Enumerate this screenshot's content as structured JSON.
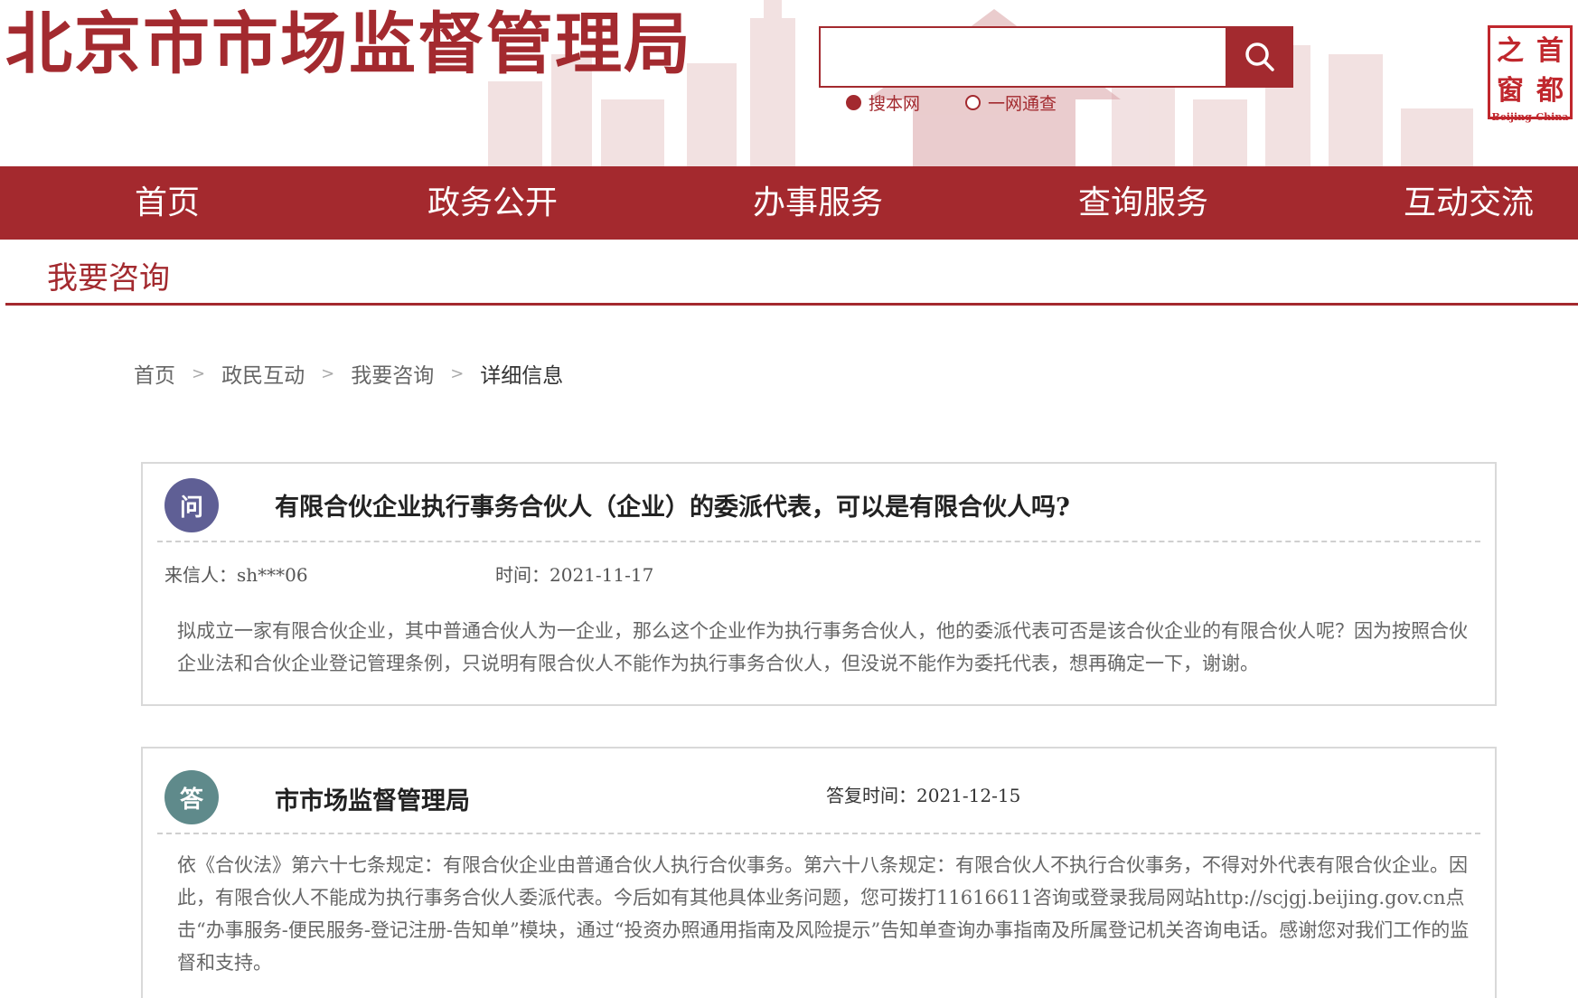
{
  "header": {
    "site_title": "北京市市场监督管理局",
    "search": {
      "value": "",
      "placeholder": ""
    },
    "search_options": [
      {
        "label": "搜本网",
        "selected": true
      },
      {
        "label": "一网通查",
        "selected": false
      }
    ],
    "logo": {
      "chars": [
        "之",
        "首",
        "窗",
        "都"
      ],
      "sub": "Beijing-China"
    },
    "accent_color": "#a4292e"
  },
  "nav": {
    "items": [
      "首页",
      "政务公开",
      "办事服务",
      "查询服务",
      "互动交流"
    ]
  },
  "section": {
    "title": "我要咨询"
  },
  "breadcrumb": {
    "items": [
      "首页",
      "政民互动",
      "我要咨询",
      "详细信息"
    ],
    "separator": ">"
  },
  "question": {
    "badge": "问",
    "title": "有限合伙企业执行事务合伙人（企业）的委派代表，可以是有限合伙人吗?",
    "sender_label": "来信人：",
    "sender": "sh***06",
    "time_label": "时间：",
    "time": "2021-11-17",
    "content": "拟成立一家有限合伙企业，其中普通合伙人为一企业，那么这个企业作为执行事务合伙人，他的委派代表可否是该合伙企业的有限合伙人呢？因为按照合伙企业法和合伙企业登记管理条例，只说明有限合伙人不能作为执行事务合伙人，但没说不能作为委托代表，想再确定一下，谢谢。"
  },
  "answer": {
    "badge": "答",
    "org": "市市场监督管理局",
    "time_label": "答复时间：",
    "time": "2021-12-15",
    "content": "依《合伙法》第六十七条规定：有限合伙企业由普通合伙人执行合伙事务。第六十八条规定：有限合伙人不执行合伙事务，不得对外代表有限合伙企业。因此，有限合伙人不能成为执行事务合伙人委派代表。今后如有其他具体业务问题，您可拨打11616611咨询或登录我局网站http://scjgj.beijing.gov.cn点击“办事服务-便民服务-登记注册-告知单”模块，通过“投资办照通用指南及风险提示”告知单查询办事指南及所属登记机关咨询电话。感谢您对我们工作的监督和支持。"
  }
}
